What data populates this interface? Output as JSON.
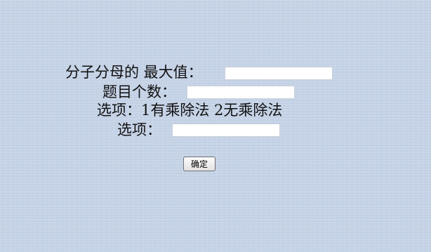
{
  "form": {
    "max_value_label": "分子分母的 最大值：",
    "max_value_input": "",
    "question_count_label": "题目个数：",
    "question_count_input": "",
    "options_hint": "选项：1有乘除法 2无乘除法",
    "option_label": "选项：",
    "option_input": "",
    "confirm_label": "确定"
  }
}
